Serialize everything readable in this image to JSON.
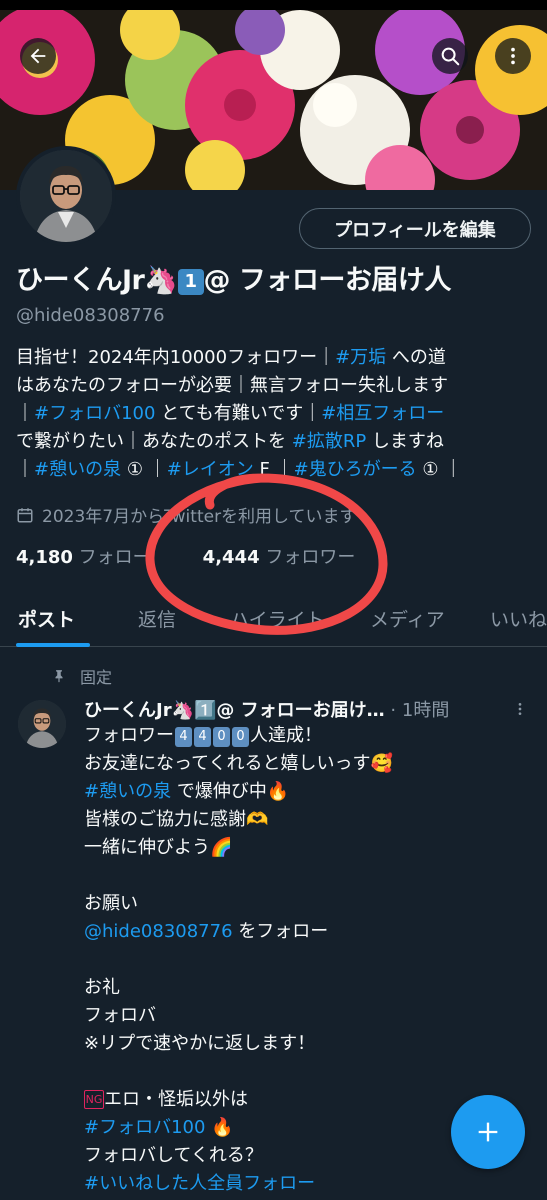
{
  "header": {
    "back_icon": "arrow-left-icon",
    "search_icon": "search-icon",
    "more_icon": "more-vertical-icon"
  },
  "profile": {
    "edit_button": "プロフィールを編集",
    "name_prefix": "ひーくんJr",
    "name_suffix": "@ フォローお届け人",
    "name_emoji_unicorn": "🦄",
    "name_emoji_one": "1",
    "handle": "@hide08308776",
    "bio": [
      [
        {
          "t": "目指せ！2024年内10000フォロワー｜"
        },
        {
          "t": "#万垢",
          "tag": true
        },
        {
          "t": " への道"
        }
      ],
      [
        {
          "t": "はあなたのフォローが必要｜無言フォロー失礼します"
        }
      ],
      [
        {
          "t": "｜"
        },
        {
          "t": "#フォロバ100",
          "tag": true
        },
        {
          "t": " とても有難いです｜"
        },
        {
          "t": "#相互フォロー",
          "tag": true
        }
      ],
      [
        {
          "t": "で繋がりたい｜あなたのポストを "
        },
        {
          "t": "#拡散RP",
          "tag": true
        },
        {
          "t": " しますね"
        }
      ],
      [
        {
          "t": "｜"
        },
        {
          "t": "#憩いの泉",
          "tag": true
        },
        {
          "t": " ① ｜"
        },
        {
          "t": "#レイオン",
          "tag": true
        },
        {
          "t": " F ｜"
        },
        {
          "t": "#鬼ひろがーる",
          "tag": true
        },
        {
          "t": " ① ｜"
        }
      ]
    ],
    "joined": "2023年7月からTwitterを利用しています",
    "following_count": "4,180",
    "following_label": "フォロー",
    "followers_count": "4,444",
    "followers_label": "フォロワー"
  },
  "tabs": [
    {
      "label": "ポスト"
    },
    {
      "label": "返信"
    },
    {
      "label": "ハイライト"
    },
    {
      "label": "メディア"
    },
    {
      "label": "いいね"
    }
  ],
  "tweet": {
    "pinned_label": "固定",
    "author": "ひーくんJr🦄1️⃣@ フォローお届け…",
    "dot": "·",
    "time": "1時間",
    "line1_prefix": "フォロワー",
    "line1_digits": [
      "4",
      "4",
      "0",
      "0"
    ],
    "line1_suffix": "人達成！",
    "line2": "お友達になってくれると嬉しいっす🥰",
    "line3_tag": "#憩いの泉",
    "line3_rest": " で爆伸び中🔥",
    "line4": "皆様のご協力に感謝🫶",
    "line5": "一緒に伸びよう🌈",
    "line7": "お願い",
    "line8_mention": "@hide08308776",
    "line8_rest": " をフォロー",
    "line10": "お礼",
    "line11": "フォロバ",
    "line12": "※リプで速やかに返します！",
    "line14_badge": "NG",
    "line14_rest": "エロ・怪垢以外は",
    "line15_tag": "#フォロバ100",
    "line15_rest": " 🔥",
    "line16": "フォロバしてくれる？",
    "line17_tag": "#いいねした人全員フォロー"
  },
  "fab": {
    "icon": "plus-icon"
  },
  "colors": {
    "accent": "#1d9bf0",
    "background": "#15202b",
    "annotation": "#f04848"
  }
}
